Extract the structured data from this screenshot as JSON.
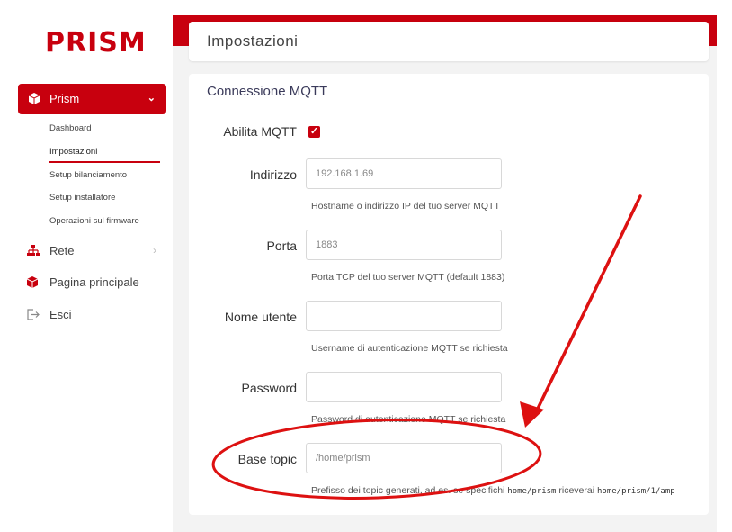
{
  "brand": {
    "logo": "PRISM",
    "accent_color": "#c8000e"
  },
  "sidebar": {
    "active_section": {
      "label": "Prism",
      "icon": "box-icon",
      "chevron": "chevron-down-icon"
    },
    "subitems": [
      "Dashboard",
      "Impostazioni",
      "Setup bilanciamento",
      "Setup installatore",
      "Operazioni sul firmware"
    ],
    "selected_subitem": "Impostazioni",
    "items": [
      {
        "label": "Rete",
        "icon": "network-icon",
        "chevron": "chevron-right-icon"
      },
      {
        "label": "Pagina principale",
        "icon": "box-icon"
      },
      {
        "label": "Esci",
        "icon": "logout-icon"
      }
    ]
  },
  "header": {
    "title": "Impostazioni"
  },
  "mqtt": {
    "section_title": "Connessione MQTT",
    "enable_label": "Abilita MQTT",
    "enable_checked": true,
    "fields": [
      {
        "label": "Indirizzo",
        "placeholder": "192.168.1.69",
        "help": "Hostname o indirizzo IP del tuo server MQTT"
      },
      {
        "label": "Porta",
        "placeholder": "1883",
        "help": "Porta TCP del tuo server MQTT (default 1883)"
      },
      {
        "label": "Nome utente",
        "placeholder": "",
        "help": "Username di autenticazione MQTT se richiesta"
      },
      {
        "label": "Password",
        "placeholder": "",
        "help": "Password di autenticazione MQTT se richiesta"
      },
      {
        "label": "Base topic",
        "placeholder": "/home/prism",
        "help_prefix": "Prefisso dei topic generati, ad es. se specifichi ",
        "help_code1": "home/prism",
        "help_mid": " riceverai ",
        "help_code2": "home/prism/1/amp"
      }
    ]
  },
  "annotation": {
    "color": "#dd1111"
  }
}
